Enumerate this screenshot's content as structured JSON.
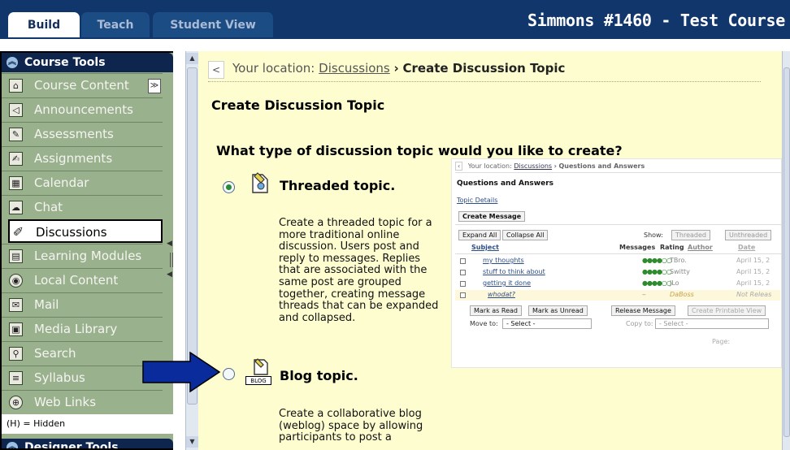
{
  "tabs": [
    {
      "label": "Build",
      "active": true
    },
    {
      "label": "Teach",
      "active": false
    },
    {
      "label": "Student View",
      "active": false
    }
  ],
  "course_title": "Simmons #1460 - Test Course",
  "sidebar": {
    "header": "Course Tools",
    "items": [
      {
        "label": "Course Content",
        "icon": "home-icon"
      },
      {
        "label": "Announcements",
        "icon": "megaphone-icon"
      },
      {
        "label": "Assessments",
        "icon": "assessment-icon"
      },
      {
        "label": "Assignments",
        "icon": "assignment-icon"
      },
      {
        "label": "Calendar",
        "icon": "calendar-icon"
      },
      {
        "label": "Chat",
        "icon": "chat-bubble-icon"
      },
      {
        "label": "Discussions",
        "icon": "discussion-pin-icon",
        "selected": true
      },
      {
        "label": "Learning Modules",
        "icon": "module-icon"
      },
      {
        "label": "Local Content",
        "icon": "disc-icon"
      },
      {
        "label": "Mail",
        "icon": "envelope-icon"
      },
      {
        "label": "Media Library",
        "icon": "media-icon"
      },
      {
        "label": "Search",
        "icon": "magnifier-icon"
      },
      {
        "label": "Syllabus",
        "icon": "syllabus-icon"
      },
      {
        "label": "Web Links",
        "icon": "globe-icon"
      }
    ],
    "hidden_note": "(H) = Hidden",
    "footer_header": "Designer Tools"
  },
  "breadcrumb": {
    "prefix": "Your location:",
    "link": "Discussions",
    "separator": "›",
    "current": "Create Discussion Topic"
  },
  "page_heading": "Create Discussion Topic",
  "question": "What type of discussion topic would you like to create?",
  "options": [
    {
      "label": "Threaded topic.",
      "selected": true,
      "description": "Create a threaded topic for a more traditional online discussion. Users post and reply to messages. Replies that are associated with the same post are grouped together, creating message threads that can be expanded and collapsed."
    },
    {
      "label": "Blog topic.",
      "selected": false,
      "badge": "BLOG",
      "description": "Create a collaborative blog (weblog) space by allowing participants to post a"
    }
  ],
  "preview": {
    "crumb_prefix": "Your location:",
    "crumb_link": "Discussions",
    "crumb_current": "Questions and Answers",
    "title": "Questions and Answers",
    "details_link": "Topic Details",
    "create_btn": "Create Message",
    "expand_btn": "Expand All",
    "collapse_btn": "Collapse All",
    "show_label": "Show:",
    "threaded_btn": "Threaded",
    "unthreaded_btn": "Unthreaded",
    "columns": [
      "Subject",
      "Messages",
      "Rating",
      "Author",
      "Date"
    ],
    "rows": [
      {
        "subject": "my thoughts",
        "rating": "●●●●○○",
        "author": "TBro.",
        "date": "April 15, 2"
      },
      {
        "subject": "stuff to think about",
        "rating": "●●●●○○",
        "author": "Switty",
        "date": "April 15, 2"
      },
      {
        "subject": "getting it done",
        "rating": "●●●●○○",
        "author": "JLo",
        "date": "April 15, 2"
      },
      {
        "subject": "whodat?",
        "rating": "--",
        "author": "DaBoss",
        "date": "Not Releas"
      }
    ],
    "mark_read_btn": "Mark as Read",
    "mark_unread_btn": "Mark as Unread",
    "release_btn": "Release Message",
    "printable_btn": "Create Printable View",
    "move_to_label": "Move to:",
    "copy_to_label": "Copy to:",
    "select_placeholder": "- Select -",
    "page_label": "Page:"
  },
  "accent_colors": {
    "top_bar": "#10366b",
    "sidebar_bg": "#9ab18e",
    "main_bg": "#fefdd0",
    "arrow": "#0a2b9c"
  }
}
